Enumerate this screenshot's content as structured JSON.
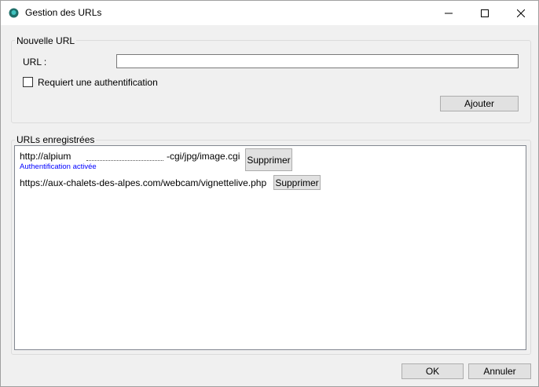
{
  "window": {
    "title": "Gestion des URLs",
    "icon": "app-icon"
  },
  "new_url": {
    "group_label": "Nouvelle URL",
    "url_label": "URL :",
    "url_value": "",
    "auth_checkbox_label": "Requiert une authentification",
    "auth_checked": false,
    "add_button": "Ajouter"
  },
  "saved_urls": {
    "group_label": "URLs enregistrées",
    "items": [
      {
        "url_start": "http://alpium",
        "url_end": "-cgi/jpg/image.cgi",
        "note": "Authentification activée",
        "delete_label": "Supprimer"
      },
      {
        "url": "https://aux-chalets-des-alpes.com/webcam/vignettelive.php",
        "delete_label": "Supprimer"
      }
    ]
  },
  "footer": {
    "ok_button": "OK",
    "cancel_button": "Annuler"
  },
  "colors": {
    "window_bg": "#f0f0f0",
    "titlebar_bg": "#ffffff",
    "note_text": "#0000ff",
    "button_bg": "#e1e1e1"
  }
}
